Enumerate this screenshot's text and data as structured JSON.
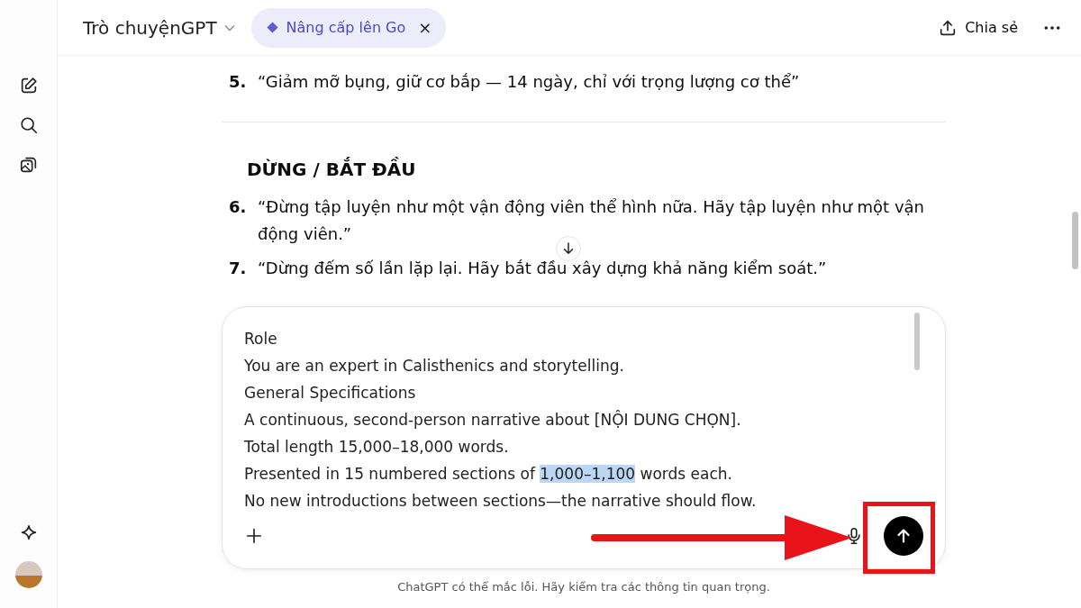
{
  "header": {
    "title": "Trò chuyệnGPT",
    "upgrade": {
      "label": "Nâng cấp lên Go",
      "close": "×"
    },
    "share": "Chia sẻ"
  },
  "content": {
    "blocks": [
      {
        "kind": "item",
        "number": "5.",
        "text": "“Giảm mỡ bụng, giữ cơ bắp — 14 ngày, chỉ với trọng lượng cơ thể”"
      },
      {
        "kind": "rule"
      },
      {
        "kind": "heading",
        "text": "DỪNG / BẮT ĐẦU"
      },
      {
        "kind": "item",
        "number": "6.",
        "text": "“Đừng tập luyện như một vận động viên thể hình nữa. Hãy tập luyện như một vận động viên.”"
      },
      {
        "kind": "item",
        "number": "7.",
        "text": "“Dừng đếm số lần lặp lại. Hãy bắt đầu xây dựng khả năng kiểm soát.”"
      }
    ]
  },
  "composer": {
    "lines": [
      [
        {
          "text": "Role",
          "selected": false
        }
      ],
      [
        {
          "text": "You are an expert in Calisthenics and storytelling.",
          "selected": false
        }
      ],
      [
        {
          "text": "General Specifications",
          "selected": false
        }
      ],
      [
        {
          "text": "A continuous, second-person narrative about [NỘI DUNG CHỌN].",
          "selected": false
        }
      ],
      [
        {
          "text": "Total length 15,000–18,000 words.",
          "selected": false
        }
      ],
      [
        {
          "text": "Presented in 15 numbered sections of ",
          "selected": false
        },
        {
          "text": "1,000–1,100",
          "selected": true
        },
        {
          "text": " words each.",
          "selected": false
        }
      ],
      [
        {
          "text": "No new introductions between sections—the narrative should flow.",
          "selected": false
        }
      ]
    ]
  },
  "footer": "ChatGPT có thể mắc lỗi. Hãy kiểm tra các thông tin quan trọng."
}
